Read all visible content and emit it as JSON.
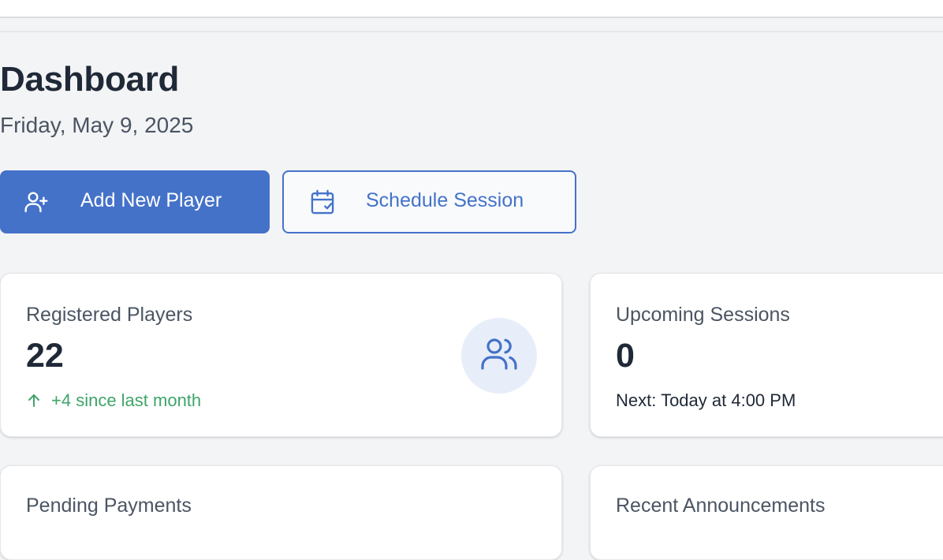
{
  "header": {
    "title": "Dashboard",
    "date": "Friday, May 9, 2025"
  },
  "actions": {
    "add_player": {
      "label": "Add New Player",
      "icon": "user-plus-icon"
    },
    "schedule_session": {
      "label": "Schedule Session",
      "icon": "calendar-check-icon"
    }
  },
  "stats": {
    "registered_players": {
      "label": "Registered Players",
      "value": "22",
      "trend": "+4 since last month",
      "trend_icon": "arrow-up-icon",
      "icon": "users-icon"
    },
    "upcoming_sessions": {
      "label": "Upcoming Sessions",
      "value": "0",
      "note": "Next: Today at 4:00 PM"
    },
    "pending_payments": {
      "label": "Pending Payments"
    },
    "recent_announcements": {
      "label": "Recent Announcements"
    }
  },
  "colors": {
    "primary": "#4472c9",
    "positive": "#3fa46a",
    "background": "#f3f4f6",
    "text": "#1f2937",
    "muted": "#4b5563"
  }
}
